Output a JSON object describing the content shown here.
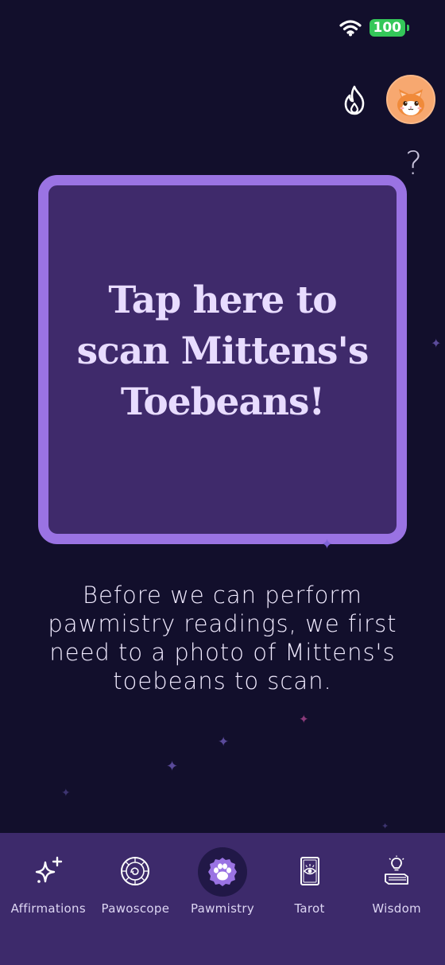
{
  "status_bar": {
    "battery": "100"
  },
  "header": {
    "help_label": "?"
  },
  "scan_card": {
    "title": "Tap here to scan Mittens's Toebeans!"
  },
  "info": {
    "text": "Before we can perform pawmistry readings, we first need to a photo of Mittens's toebeans to scan."
  },
  "bottom_nav": {
    "items": [
      {
        "label": "Affirmations",
        "icon": "sparkles-icon"
      },
      {
        "label": "Pawoscope",
        "icon": "zodiac-wheel-icon"
      },
      {
        "label": "Pawmistry",
        "icon": "paw-icon",
        "active": true
      },
      {
        "label": "Tarot",
        "icon": "tarot-card-icon"
      },
      {
        "label": "Wisdom",
        "icon": "book-lightbulb-icon"
      }
    ]
  },
  "colors": {
    "background": "#120f2c",
    "card_fill": "#3f2a6b",
    "card_border": "#9a73e3",
    "nav_background": "#3d2a6b",
    "battery": "#34c759",
    "avatar": "#f7a870"
  }
}
